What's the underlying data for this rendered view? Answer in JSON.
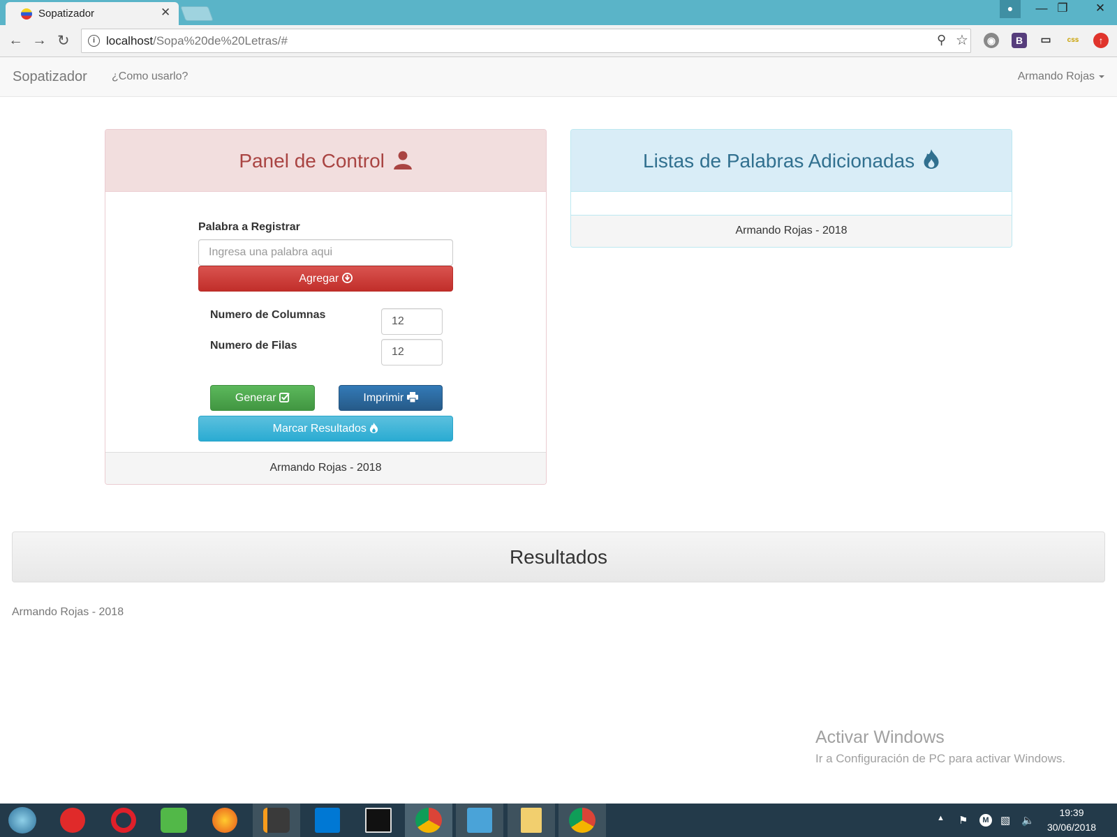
{
  "browser": {
    "tab_title": "Sopatizador",
    "tab_close": "✕",
    "url_host": "localhost",
    "url_path": "/Sopa%20de%20Letras/#"
  },
  "navbar": {
    "brand": "Sopatizador",
    "link_help": "¿Como usarlo?",
    "user": "Armando Rojas"
  },
  "control_panel": {
    "title": "Panel de Control",
    "word_label": "Palabra a Registrar",
    "word_placeholder": "Ingresa una palabra aqui",
    "add_button": "Agregar",
    "columns_label": "Numero de Columnas",
    "columns_value": "12",
    "rows_label": "Numero de Filas",
    "rows_value": "12",
    "generate_button": "Generar",
    "print_button": "Imprimir",
    "mark_button": "Marcar Resultados",
    "footer": "Armando Rojas - 2018"
  },
  "words_panel": {
    "title": "Listas de Palabras Adicionadas",
    "footer": "Armando Rojas - 2018"
  },
  "results": {
    "title": "Resultados",
    "footer": "Armando Rojas - 2018"
  },
  "watermark": {
    "line1": "Activar Windows",
    "line2": "Ir a Configuración de PC para activar Windows."
  },
  "taskbar": {
    "time": "19:39",
    "date": "30/06/2018",
    "apps": [
      "start",
      "media-player",
      "opera",
      "wifi-manager",
      "firefox",
      "sublime-text",
      "vscode",
      "terminal",
      "chrome",
      "video-player",
      "file-explorer",
      "chrome"
    ]
  }
}
